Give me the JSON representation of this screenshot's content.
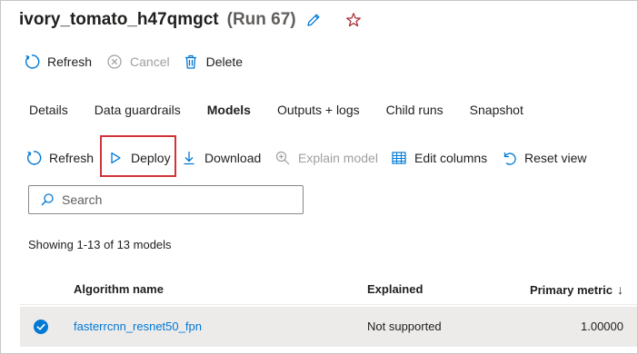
{
  "header": {
    "run_name": "ivory_tomato_h47qmgct",
    "run_number": "(Run 67)",
    "edit_icon": "pencil-icon",
    "favorite_icon": "star-icon"
  },
  "run_commands": {
    "refresh_label": "Refresh",
    "cancel_label": "Cancel",
    "delete_label": "Delete"
  },
  "tabs": [
    {
      "label": "Details",
      "active": false
    },
    {
      "label": "Data guardrails",
      "active": false
    },
    {
      "label": "Models",
      "active": true
    },
    {
      "label": "Outputs + logs",
      "active": false
    },
    {
      "label": "Child runs",
      "active": false
    },
    {
      "label": "Snapshot",
      "active": false
    }
  ],
  "models_toolbar": {
    "refresh_label": "Refresh",
    "deploy_label": "Deploy",
    "download_label": "Download",
    "explain_label": "Explain model",
    "edit_columns_label": "Edit columns",
    "reset_view_label": "Reset view"
  },
  "search": {
    "placeholder": "Search"
  },
  "summary": {
    "showing_text": "Showing 1-13 of 13 models"
  },
  "table": {
    "columns": {
      "algorithm": "Algorithm name",
      "explained": "Explained",
      "primary_metric": "Primary metric",
      "sort_indicator": "↓"
    },
    "rows": [
      {
        "algorithm": "fasterrcnn_resnet50_fpn",
        "explained": "Not supported",
        "primary_metric": "1.00000",
        "selected": true
      }
    ]
  },
  "colors": {
    "accent": "#0078d4",
    "highlight_box": "#d13438",
    "star": "#a4262c",
    "disabled": "#a19f9d",
    "selected_row": "#edebe9"
  }
}
